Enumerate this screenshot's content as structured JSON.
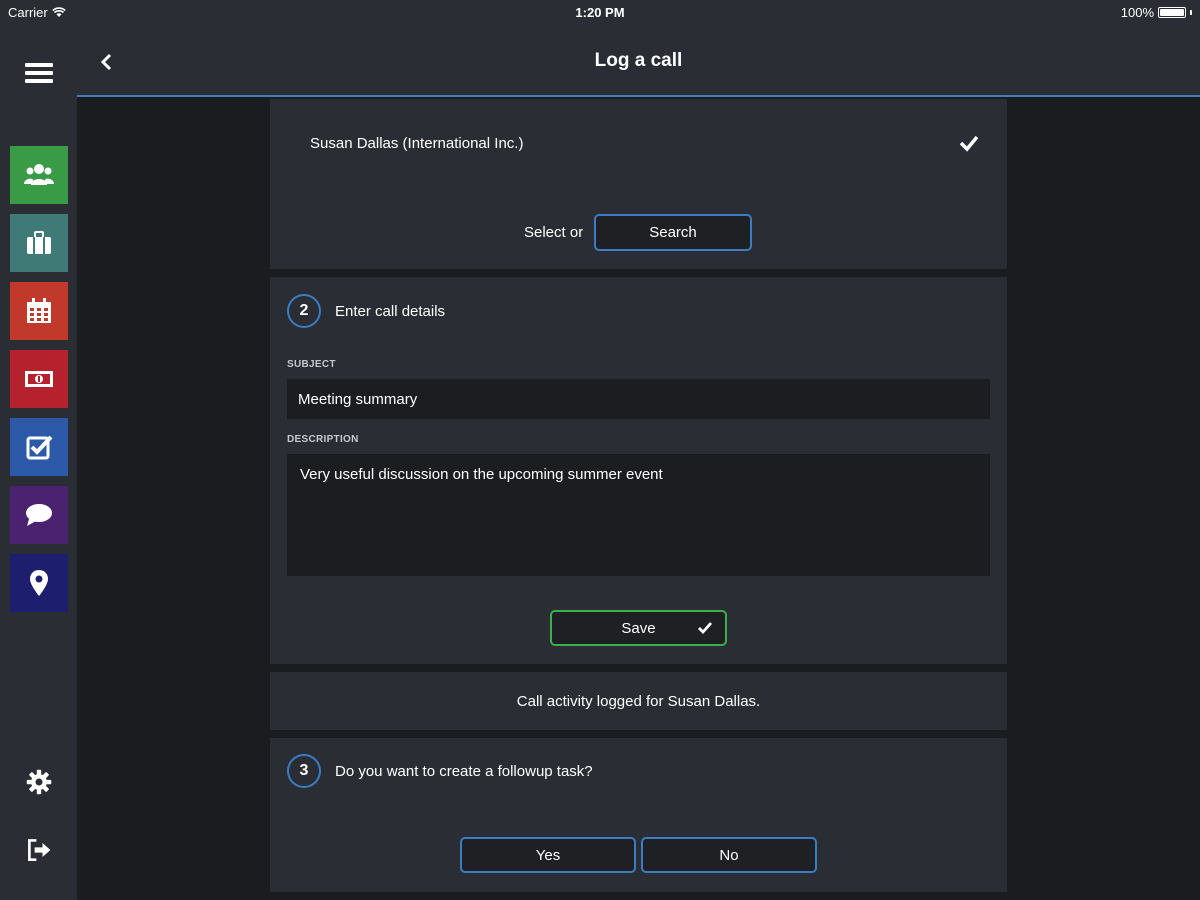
{
  "status_bar": {
    "carrier": "Carrier",
    "time": "1:20 PM",
    "battery": "100%"
  },
  "header": {
    "title": "Log a call"
  },
  "sidebar": {
    "items": [
      {
        "name": "contacts",
        "icon": "users-icon",
        "color": "#3a9b47"
      },
      {
        "name": "accounts",
        "icon": "briefcase-icon",
        "color": "#3f7a76"
      },
      {
        "name": "calendar",
        "icon": "calendar-icon",
        "color": "#c0392b"
      },
      {
        "name": "opportunities",
        "icon": "money-icon",
        "color": "#b5222e"
      },
      {
        "name": "tasks",
        "icon": "checkbox-icon",
        "color": "#2c5aa8"
      },
      {
        "name": "chat",
        "icon": "chat-bubble-icon",
        "color": "#4a2270"
      },
      {
        "name": "location",
        "icon": "map-pin-icon",
        "color": "#1d1f6e"
      }
    ],
    "settings_icon": "gear-icon",
    "logout_icon": "logout-icon"
  },
  "step1": {
    "contact": "Susan Dallas (International Inc.)",
    "select_or": "Select or",
    "search_label": "Search"
  },
  "step2": {
    "number": "2",
    "title": "Enter call details",
    "subject_label": "SUBJECT",
    "subject_value": "Meeting summary",
    "description_label": "DESCRIPTION",
    "description_value": "Very useful discussion on the upcoming summer event",
    "save_label": "Save"
  },
  "log_message": "Call activity logged for Susan Dallas.",
  "step3": {
    "number": "3",
    "question": "Do you want to create a followup task?",
    "yes_label": "Yes",
    "no_label": "No"
  },
  "colors": {
    "accent": "#3a7dc4",
    "save_border": "#3fae49",
    "panel": "#2a2d33",
    "background": "#1b1c20"
  }
}
